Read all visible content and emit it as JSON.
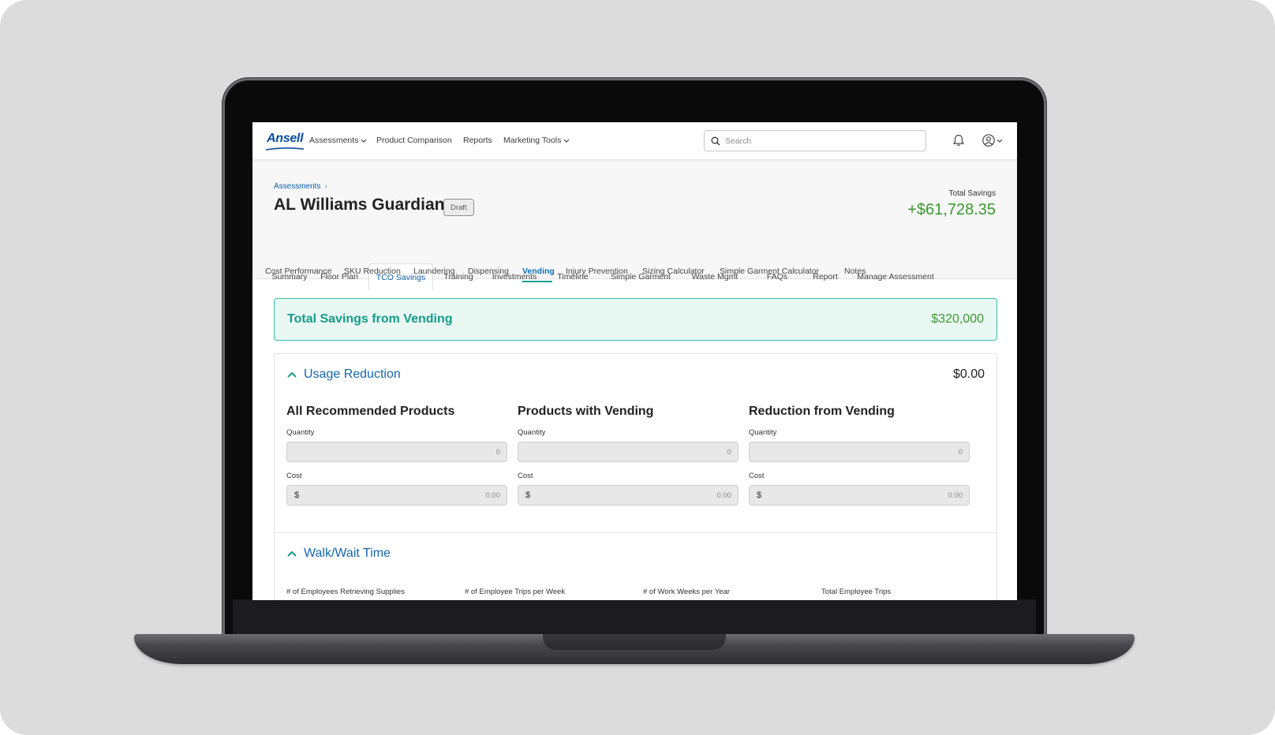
{
  "nav": {
    "logo": "Ansell",
    "items": [
      {
        "label": "Assessments",
        "dropdown": true
      },
      {
        "label": "Product Comparison",
        "dropdown": false
      },
      {
        "label": "Reports",
        "dropdown": false
      },
      {
        "label": "Marketing Tools",
        "dropdown": true
      }
    ],
    "search_placeholder": "Search"
  },
  "header": {
    "breadcrumb": "Assessments",
    "title": "AL Williams Guardian",
    "status_badge": "Draft",
    "total_savings_label": "Total Savings",
    "total_savings_value": "+$61,728.35"
  },
  "main_tabs": [
    {
      "label": "Summary"
    },
    {
      "label": "Floor Plan"
    },
    {
      "label": "TCO Savings",
      "active": true
    },
    {
      "label": "Training"
    },
    {
      "label": "Investments"
    },
    {
      "label": "Timeline"
    },
    {
      "label": "Simple Garment"
    },
    {
      "label": "Waste Mgmt"
    },
    {
      "label": "FAQs"
    },
    {
      "label": "Report"
    },
    {
      "label": "Manage Assessment"
    }
  ],
  "sub_tabs": [
    {
      "label": "Cost Performance"
    },
    {
      "label": "SKU Reduction"
    },
    {
      "label": "Laundering"
    },
    {
      "label": "Dispensing"
    },
    {
      "label": "Vending",
      "active": true
    },
    {
      "label": "Injury Prevention"
    },
    {
      "label": "Sizing Calculator"
    },
    {
      "label": "Simple Garment Calculator"
    },
    {
      "label": "Notes"
    }
  ],
  "banner": {
    "title": "Total Savings from Vending",
    "value": "$320,000"
  },
  "usage_reduction": {
    "title": "Usage Reduction",
    "amount": "$0.00",
    "columns": [
      {
        "title": "All Recommended Products",
        "quantity_label": "Quantity",
        "quantity": "0",
        "cost_label": "Cost",
        "currency": "$",
        "cost": "0.00"
      },
      {
        "title": "Products with Vending",
        "quantity_label": "Quantity",
        "quantity": "0",
        "cost_label": "Cost",
        "currency": "$",
        "cost": "0.00"
      },
      {
        "title": "Reduction from Vending",
        "quantity_label": "Quantity",
        "quantity": "0",
        "cost_label": "Cost",
        "currency": "$",
        "cost": "0.00"
      }
    ]
  },
  "walk_wait": {
    "title": "Walk/Wait Time",
    "labels": [
      "# of Employees Retrieving Supplies",
      "# of Employee Trips per Week",
      "# of Work Weeks per Year",
      "Total Employee Trips"
    ]
  },
  "colors": {
    "brand_blue": "#0b4ea2",
    "link_blue": "#0b5cad",
    "teal": "#149c89",
    "savings_green": "#3a9a2e",
    "banner_bg": "#eaf8f4"
  }
}
